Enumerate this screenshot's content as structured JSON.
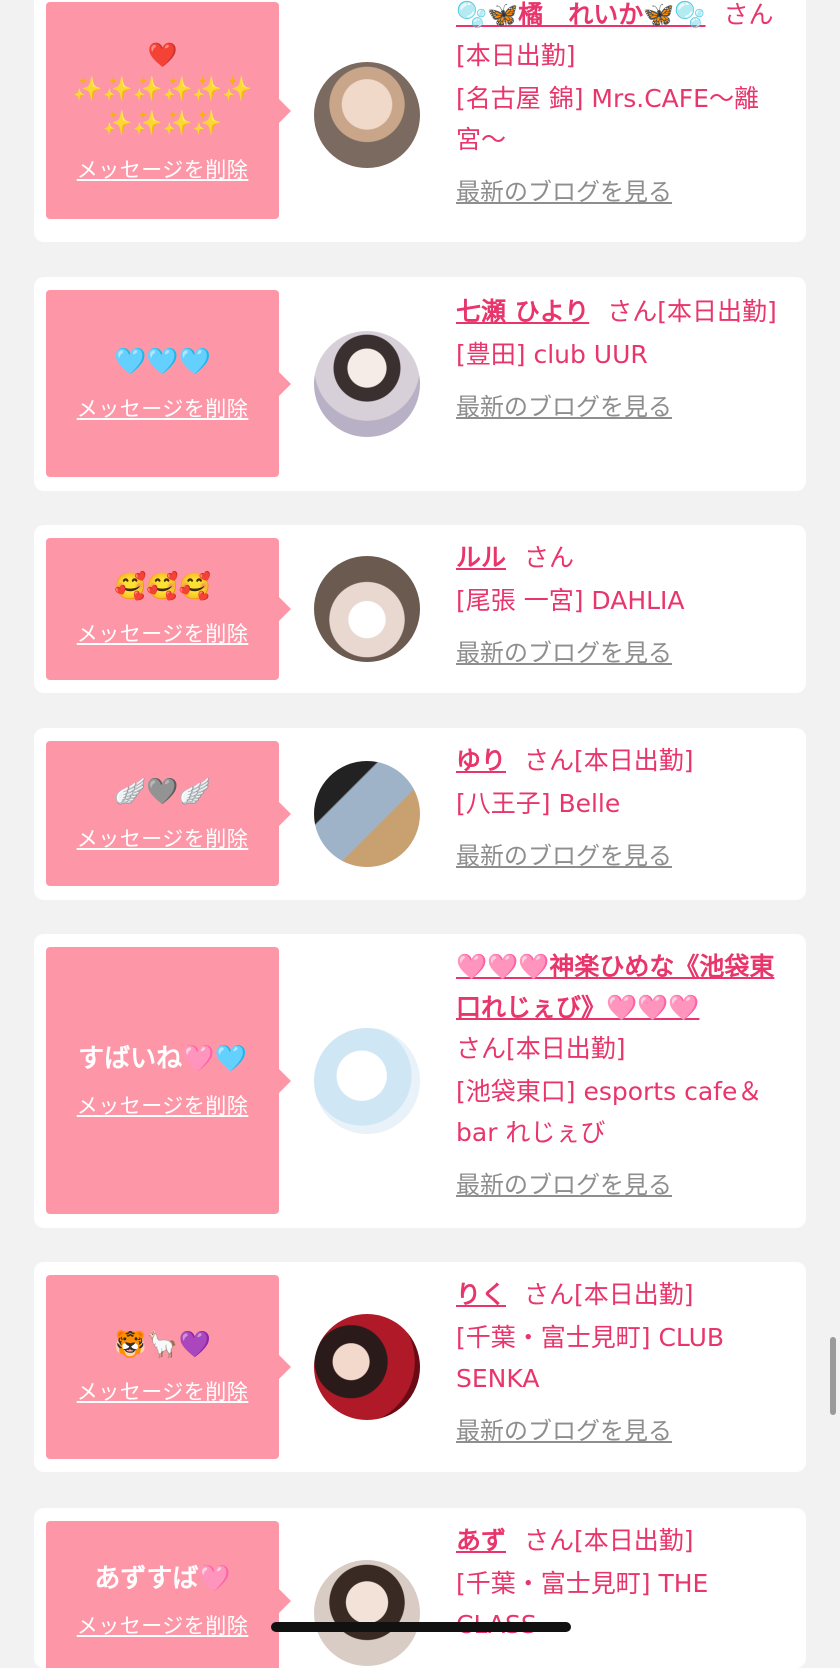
{
  "delete_label": "メッセージを削除",
  "blog_label": "最新のブログを見る",
  "san_label": "さん",
  "cards": [
    {
      "message": "❤️\n✨✨✨✨✨✨\n✨✨✨✨",
      "name": "🫧🦋橘　れいか🦋🫧",
      "status": "[本日出勤]",
      "shop": "[名古屋 錦] Mrs.CAFE〜離宮〜"
    },
    {
      "message": "🩵🩵🩵",
      "name": "七瀬 ひより",
      "status": "[本日出勤]",
      "shop": "[豊田] club UUR"
    },
    {
      "message": "🥰🥰🥰",
      "name": "ルル",
      "status": "",
      "shop": "[尾張 一宮] DAHLIA"
    },
    {
      "message": "🪽🩶🪽",
      "name": "ゆり",
      "status": "[本日出勤]",
      "shop": "[八王子] Belle"
    },
    {
      "message": "すばいね🩷🩵",
      "name": "🩷🩷🩷神楽ひめな《池袋東口れじぇび》🩷🩷🩷",
      "status": "[本日出勤]",
      "shop": "[池袋東口] esports cafe＆bar れじぇび"
    },
    {
      "message": "🐯🦙💜",
      "name": "りく",
      "status": "[本日出勤]",
      "shop": "[千葉・富士見町] CLUB SENKA"
    },
    {
      "message": "あずすば🩷",
      "name": "あず",
      "status": "[本日出勤]",
      "shop": "[千葉・富士見町] THE CLASS"
    }
  ]
}
